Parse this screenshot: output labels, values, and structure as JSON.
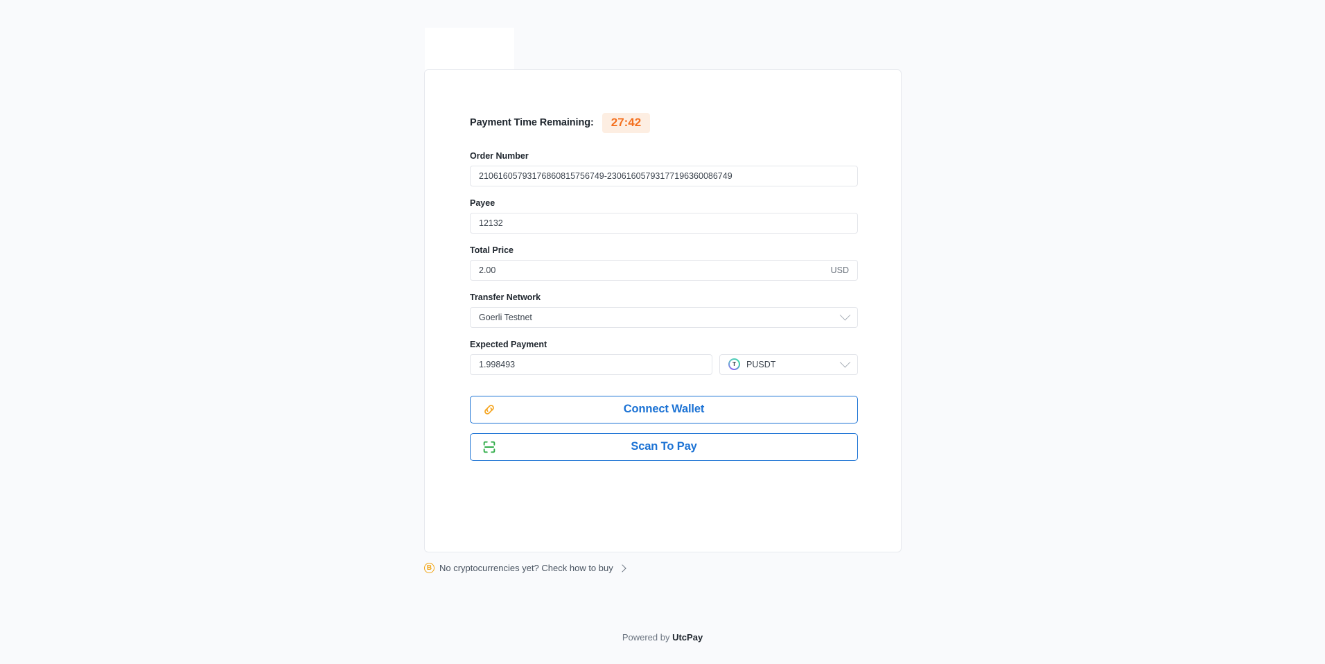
{
  "brand": {
    "powered_prefix": "Powered by",
    "powered_name": "UtcPay",
    "accent_blue": "#1b72d4",
    "accent_orange": "#f4701f",
    "accent_green": "#32ad4a",
    "badge_bg": "#fdeee2",
    "page_bg": "#f9fafc"
  },
  "timer": {
    "label": "Payment Time Remaining:",
    "value": "27:42"
  },
  "fields": {
    "order_number": {
      "label": "Order Number",
      "value": "21061605793176860815756749-23061605793177196360086749"
    },
    "payee": {
      "label": "Payee",
      "value": "12132"
    },
    "total_price": {
      "label": "Total Price",
      "value": "2.00",
      "currency": "USD"
    },
    "transfer_network": {
      "label": "Transfer Network",
      "value": "Goerli Testnet"
    },
    "expected_payment": {
      "label": "Expected Payment",
      "value": "1.998493",
      "token": "PUSDT",
      "token_symbol": "T"
    }
  },
  "actions": {
    "connect_wallet": {
      "label": "Connect Wallet",
      "icon": "link-icon"
    },
    "scan_to_pay": {
      "label": "Scan To Pay",
      "icon": "scan-icon"
    }
  },
  "buy_link": {
    "icon": "bitcoin-icon",
    "text": "No cryptocurrencies yet? Check how to buy",
    "symbol": "B"
  }
}
